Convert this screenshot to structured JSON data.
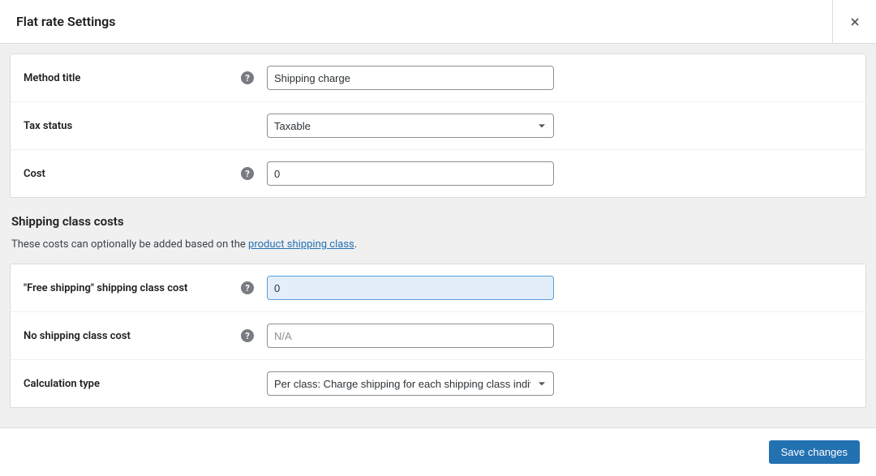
{
  "header": {
    "title": "Flat rate Settings"
  },
  "settings": {
    "method_title": {
      "label": "Method title",
      "value": "Shipping charge"
    },
    "tax_status": {
      "label": "Tax status",
      "selected": "Taxable"
    },
    "cost": {
      "label": "Cost",
      "value": "0"
    }
  },
  "shipping_class": {
    "heading": "Shipping class costs",
    "description_prefix": "These costs can optionally be added based on the ",
    "description_link": "product shipping class",
    "description_suffix": ".",
    "free_shipping": {
      "label": "\"Free shipping\" shipping class cost",
      "value": "0"
    },
    "no_shipping": {
      "label": "No shipping class cost",
      "placeholder": "N/A",
      "value": ""
    },
    "calculation_type": {
      "label": "Calculation type",
      "selected": "Per class: Charge shipping for each shipping class individually"
    }
  },
  "footer": {
    "save_label": "Save changes"
  }
}
